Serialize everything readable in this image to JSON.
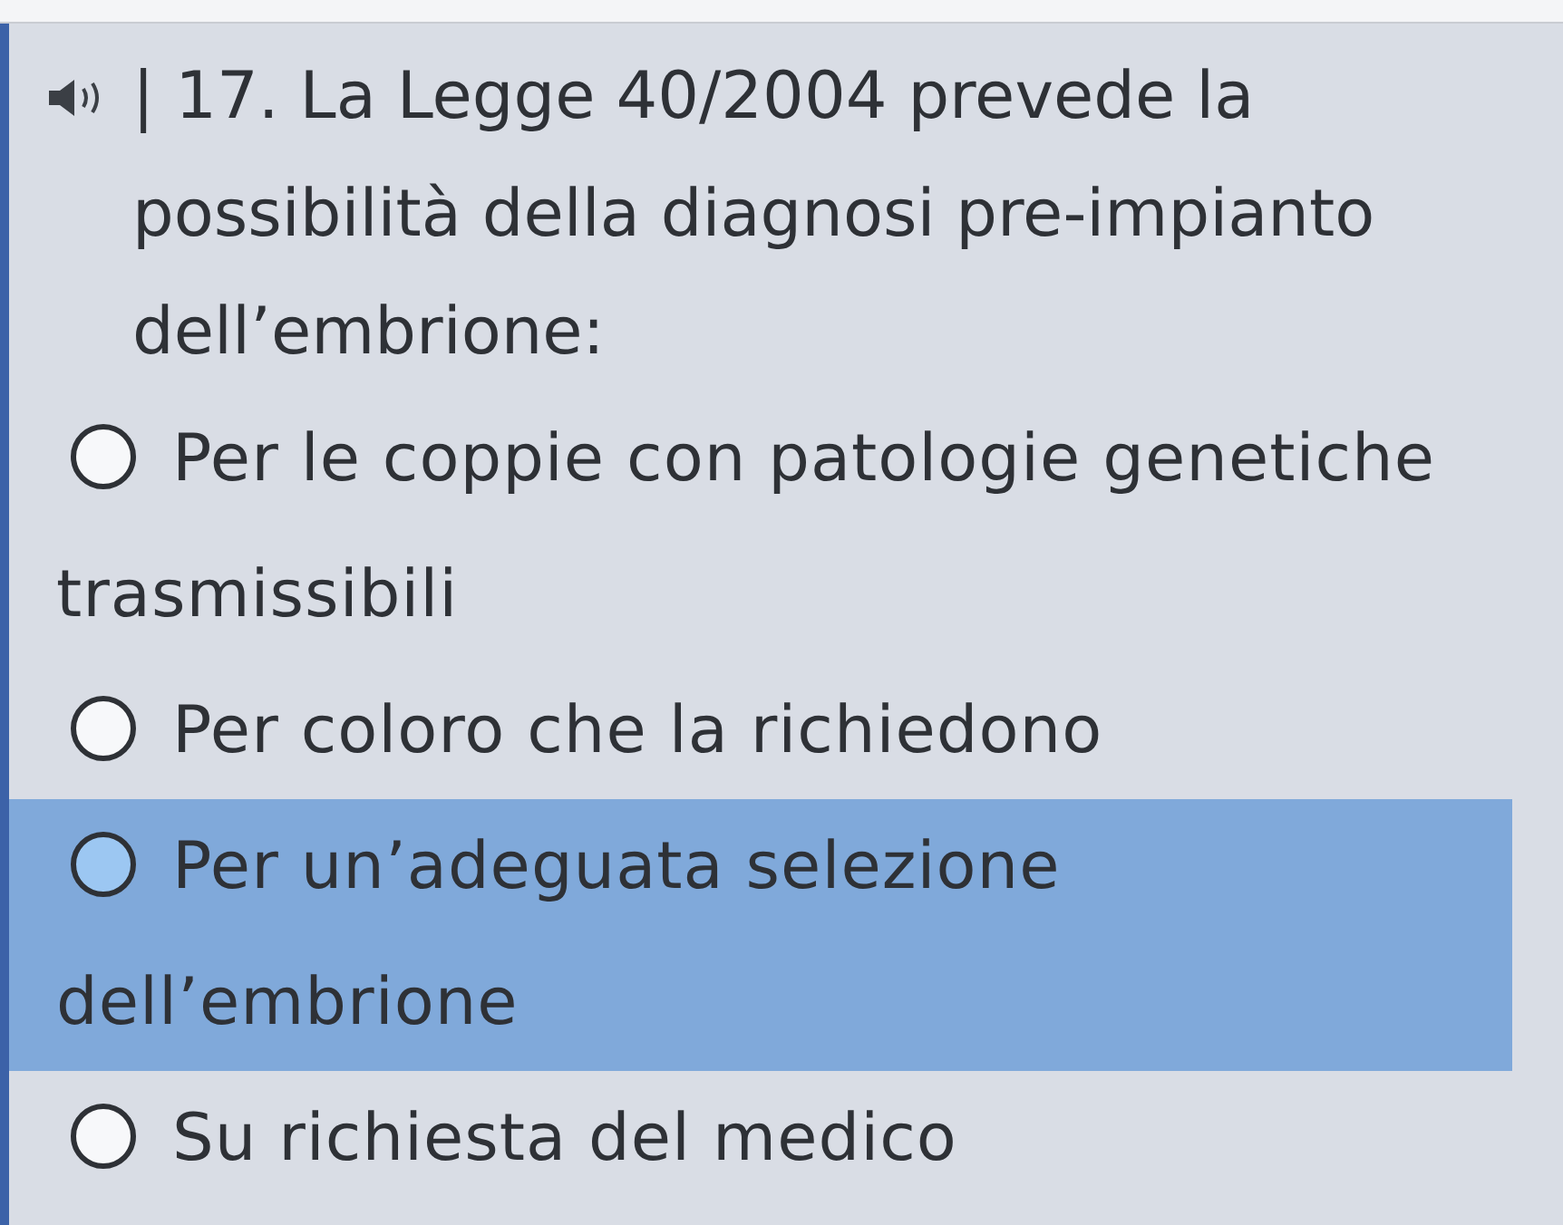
{
  "question": {
    "text": "| 17. La Legge 40/2004 prevede la possibilità della diagnosi pre-impianto dell’embrione:"
  },
  "options": [
    {
      "label": "Per le coppie con patologie genetiche trasmissibili",
      "selected": false
    },
    {
      "label": "Per coloro che la richiedono",
      "selected": false
    },
    {
      "label": "Per un’adeguata selezione dell’embrione",
      "selected": true
    },
    {
      "label": "Su richiesta del medico",
      "selected": false
    }
  ]
}
